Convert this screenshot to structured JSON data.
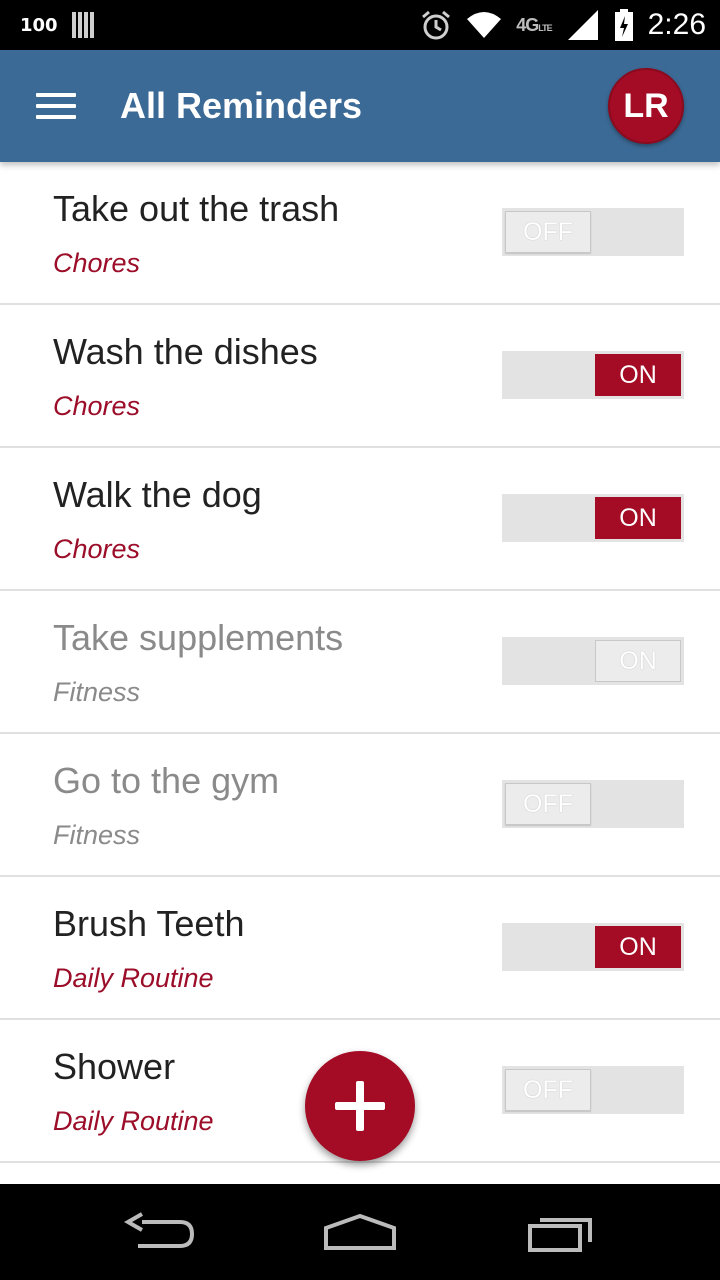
{
  "status_bar": {
    "battery_percent": "100",
    "network": "4G",
    "network_sub": "LTE",
    "time": "2:26"
  },
  "app_bar": {
    "title": "All Reminders",
    "avatar_initials": "LR"
  },
  "colors": {
    "app_bar": "#3c6a96",
    "accent": "#a30c24",
    "toggle_track": "#e3e3e3"
  },
  "reminders": [
    {
      "title": "Take out the trash",
      "category": "Chores",
      "state": "OFF",
      "enabled": true
    },
    {
      "title": "Wash the dishes",
      "category": "Chores",
      "state": "ON",
      "enabled": true
    },
    {
      "title": "Walk the dog",
      "category": "Chores",
      "state": "ON",
      "enabled": true
    },
    {
      "title": "Take supplements",
      "category": "Fitness",
      "state": "ON",
      "enabled": false
    },
    {
      "title": "Go to the gym",
      "category": "Fitness",
      "state": "OFF",
      "enabled": false
    },
    {
      "title": "Brush Teeth",
      "category": "Daily Routine",
      "state": "ON",
      "enabled": true
    },
    {
      "title": "Shower",
      "category": "Daily Routine",
      "state": "OFF",
      "enabled": true
    }
  ],
  "fab_icon": "plus-icon",
  "nav_icons": [
    "back-icon",
    "home-icon",
    "recents-icon"
  ]
}
